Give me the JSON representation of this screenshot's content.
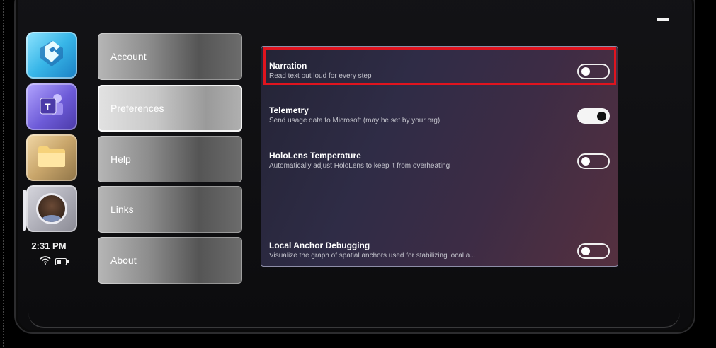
{
  "status": {
    "time": "2:31 PM",
    "wifi_icon": "wifi-icon",
    "battery_icon": "battery-icon"
  },
  "app_rail": [
    {
      "name": "store",
      "icon": "store-icon"
    },
    {
      "name": "teams",
      "icon": "teams-icon"
    },
    {
      "name": "files",
      "icon": "folder-icon"
    },
    {
      "name": "profile",
      "icon": "avatar"
    }
  ],
  "nav": {
    "items": [
      {
        "label": "Account"
      },
      {
        "label": "Preferences",
        "selected": true
      },
      {
        "label": "Help"
      },
      {
        "label": "Links"
      },
      {
        "label": "About"
      }
    ]
  },
  "settings": [
    {
      "title": "Narration",
      "description": "Read text out loud for every step",
      "enabled": false
    },
    {
      "title": "Telemetry",
      "description": "Send usage data to Microsoft (may be set by your org)",
      "enabled": true
    },
    {
      "title": "HoloLens Temperature",
      "description": "Automatically adjust HoloLens to keep it from overheating",
      "enabled": false
    },
    {
      "title": "Local Anchor Debugging",
      "description": "Visualize the graph of spatial anchors used for stabilizing local a...",
      "enabled": false
    }
  ],
  "colors": {
    "highlight": "#e0141e",
    "toggle_on": "#f4f4f4"
  }
}
